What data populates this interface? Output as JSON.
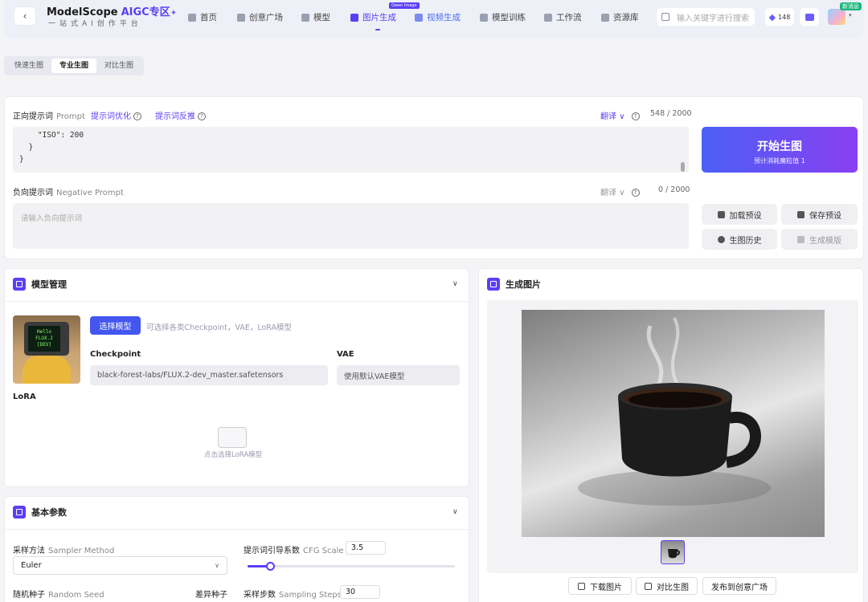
{
  "header": {
    "brand": "ModelScope",
    "brand_accent": "AIGC专区",
    "slogan": "一站式AI创作平台",
    "nav": [
      {
        "label": "首页",
        "icon": "home-icon"
      },
      {
        "label": "创意广场",
        "icon": "plaza-icon"
      },
      {
        "label": "模型",
        "icon": "model-icon"
      },
      {
        "label": "图片生成",
        "icon": "image-icon",
        "active": true,
        "badge": "Qwen Image"
      },
      {
        "label": "视频生成",
        "icon": "video-icon"
      },
      {
        "label": "模型训练",
        "icon": "training-icon"
      },
      {
        "label": "工作流",
        "icon": "workflow-icon"
      },
      {
        "label": "资源库",
        "icon": "library-icon"
      }
    ],
    "search_placeholder": "输入关键字进行搜索",
    "points": "148",
    "new_message_badge": "新消息"
  },
  "mode_tabs": [
    {
      "label": "快速生图"
    },
    {
      "label": "专业生图",
      "active": true
    },
    {
      "label": "对比生图"
    }
  ],
  "prompt": {
    "label": "正向提示词",
    "label_en": "Prompt",
    "optimize": "提示词优化",
    "reverse": "提示词反推",
    "translate": "翻译",
    "count": "548 / 2000",
    "text": "    \"ISO\": 200\n  }\n}"
  },
  "negative": {
    "label": "负向提示词",
    "label_en": "Negative Prompt",
    "translate": "翻译",
    "count": "0 / 2000",
    "placeholder": "请输入负向提示词"
  },
  "actions": {
    "generate": "开始生图",
    "cost": "预计消耗魔粒值 1",
    "load_preset": "加载预设",
    "save_preset": "保存预设",
    "history": "生图历史",
    "template": "生成模版"
  },
  "model_panel": {
    "title": "模型管理",
    "select_button": "选择模型",
    "hint": "可选择各类Checkpoint，VAE，LoRA模型",
    "thumb_text": "Hello\nFLUX.2\n[DEV]",
    "checkpoint_label": "Checkpoint",
    "checkpoint_value": "black-forest-labs/FLUX.2-dev_master.safetensors",
    "vae_label": "VAE",
    "vae_value": "使用默认VAE模型",
    "lora_label": "LoRA",
    "lora_hint": "点击选择LoRA模型"
  },
  "params_panel": {
    "title": "基本参数",
    "sampler_label": "采样方法",
    "sampler_label_en": "Sampler Method",
    "sampler_value": "Euler",
    "cfg_label": "提示词引导系数",
    "cfg_label_en": "CFG Scale",
    "cfg_value": "3.5",
    "cfg_fraction": 0.11,
    "seed_label": "随机种子",
    "seed_label_en": "Random Seed",
    "variation_seed_label": "差异种子",
    "steps_label": "采样步数",
    "steps_label_en": "Sampling Steps",
    "steps_value": "30"
  },
  "output_panel": {
    "title": "生成图片",
    "download": "下载图片",
    "compare": "对比生图",
    "publish": "发布到创意广场"
  },
  "colors": {
    "accent": "#5b3ef5",
    "gradient_start": "#4b60f5",
    "gradient_end": "#8a3ff2"
  }
}
